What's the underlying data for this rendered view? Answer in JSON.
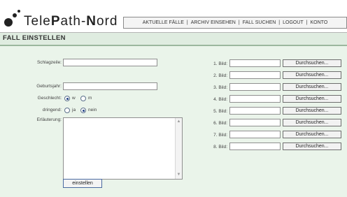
{
  "logo": {
    "text_pre": "Tele",
    "text_bold": "P",
    "text_mid": "ath-",
    "text_bold2": "N",
    "text_post": "ord"
  },
  "nav": [
    {
      "label": "AKTUELLE FÄLLE"
    },
    {
      "label": "ARCHIV EINSEHEN"
    },
    {
      "label": "FALL SUCHEN"
    },
    {
      "label": "LOGOUT"
    },
    {
      "label": "KONTO"
    }
  ],
  "nav_sep": "|",
  "page_title": "FALL EINSTELLEN",
  "form": {
    "schlagzeile_label": "Schlagzeile:",
    "schlagzeile_value": "",
    "geburtsjahr_label": "Geburtsjahr:",
    "geburtsjahr_value": "",
    "geschlecht_label": "Geschlecht:",
    "geschlecht_options": [
      {
        "label": "w",
        "checked": true
      },
      {
        "label": "m",
        "checked": false
      }
    ],
    "dringend_label": "dringend:",
    "dringend_options": [
      {
        "label": "ja",
        "checked": false
      },
      {
        "label": "nein",
        "checked": true
      }
    ],
    "erlaeuterung_label": "Erläuterung:",
    "erlaeuterung_value": "",
    "submit_label": "einstellen"
  },
  "images": [
    {
      "label": "1. Bild:",
      "button": "Durchsuchen..."
    },
    {
      "label": "2. Bild:",
      "button": "Durchsuchen..."
    },
    {
      "label": "3. Bild:",
      "button": "Durchsuchen..."
    },
    {
      "label": "4. Bild:",
      "button": "Durchsuchen..."
    },
    {
      "label": "5. Bild:",
      "button": "Durchsuchen..."
    },
    {
      "label": "6. Bild:",
      "button": "Durchsuchen..."
    },
    {
      "label": "7. Bild:",
      "button": "Durchsuchen..."
    },
    {
      "label": "8. Bild:",
      "button": "Durchsuchen..."
    }
  ],
  "icons": {
    "scroll_up": "scroll-up-arrow-icon",
    "scroll_down": "scroll-down-arrow-icon",
    "logo_dots": "logo-dots-icon"
  }
}
